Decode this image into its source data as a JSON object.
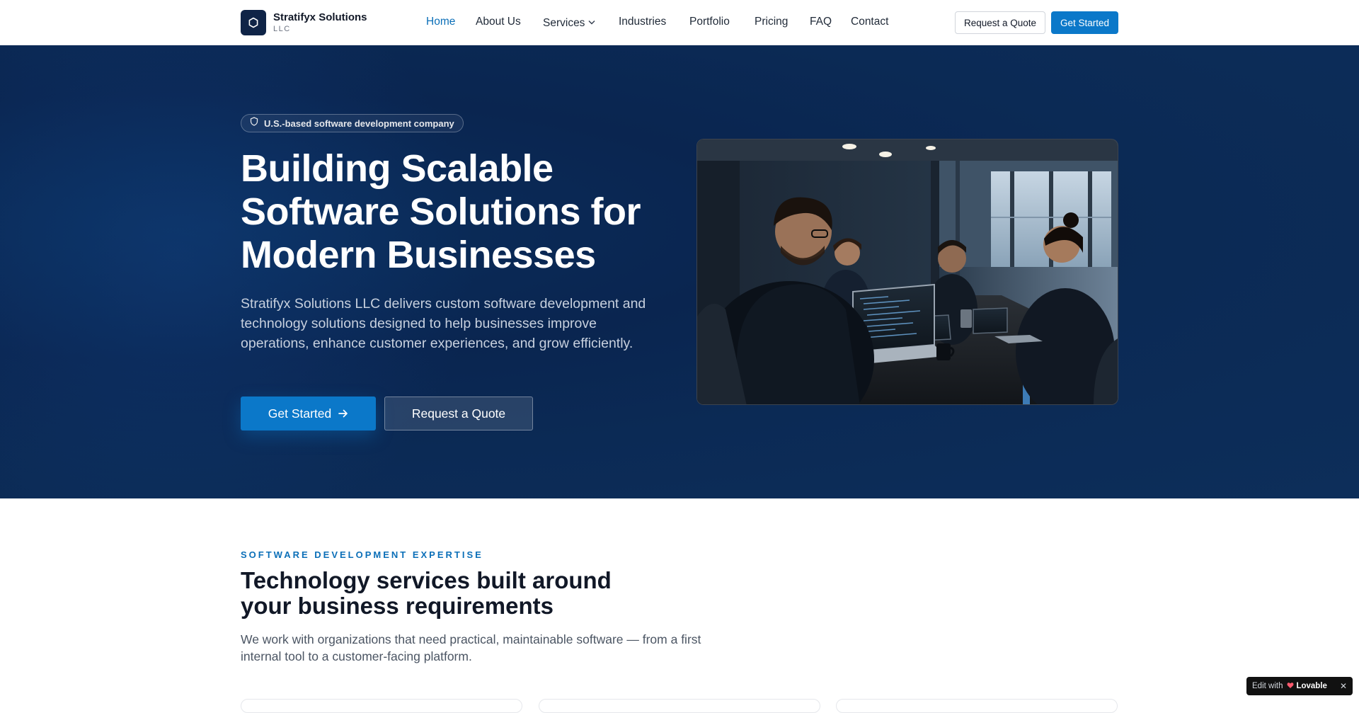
{
  "header": {
    "brand_name": "Stratifyx Solutions",
    "brand_suffix": "LLC",
    "nav": [
      {
        "label": "Home",
        "active": true
      },
      {
        "label": "About Us"
      },
      {
        "label": "Services",
        "has_dropdown": true
      },
      {
        "label": "Industries"
      },
      {
        "label": "Portfolio"
      },
      {
        "label": "Pricing"
      },
      {
        "label": "FAQ"
      },
      {
        "label": "Contact"
      }
    ],
    "quote_label": "Request a Quote",
    "start_label": "Get Started"
  },
  "hero": {
    "badge": "U.S.-based software development company",
    "title_lines": [
      "Building Scalable",
      "Software Solutions for",
      "Modern Businesses"
    ],
    "description": "Stratifyx Solutions LLC delivers custom software development and technology solutions designed to help businesses improve operations, enhance customer experiences, and grow efficiently.",
    "primary_cta": "Get Started",
    "secondary_cta": "Request a Quote"
  },
  "services": {
    "eyebrow": "SOFTWARE DEVELOPMENT EXPERTISE",
    "title_lines": [
      "Technology services built around",
      "your business requirements"
    ],
    "description": "We work with organizations that need practical, maintainable software — from a first internal tool to a customer-facing platform."
  },
  "lovable": {
    "edit_label": "Edit with",
    "brand": "Lovable"
  },
  "colors": {
    "accent": "#0b78c9",
    "hero_bg": "#0b2a55",
    "logo_bg": "#0f2447"
  }
}
